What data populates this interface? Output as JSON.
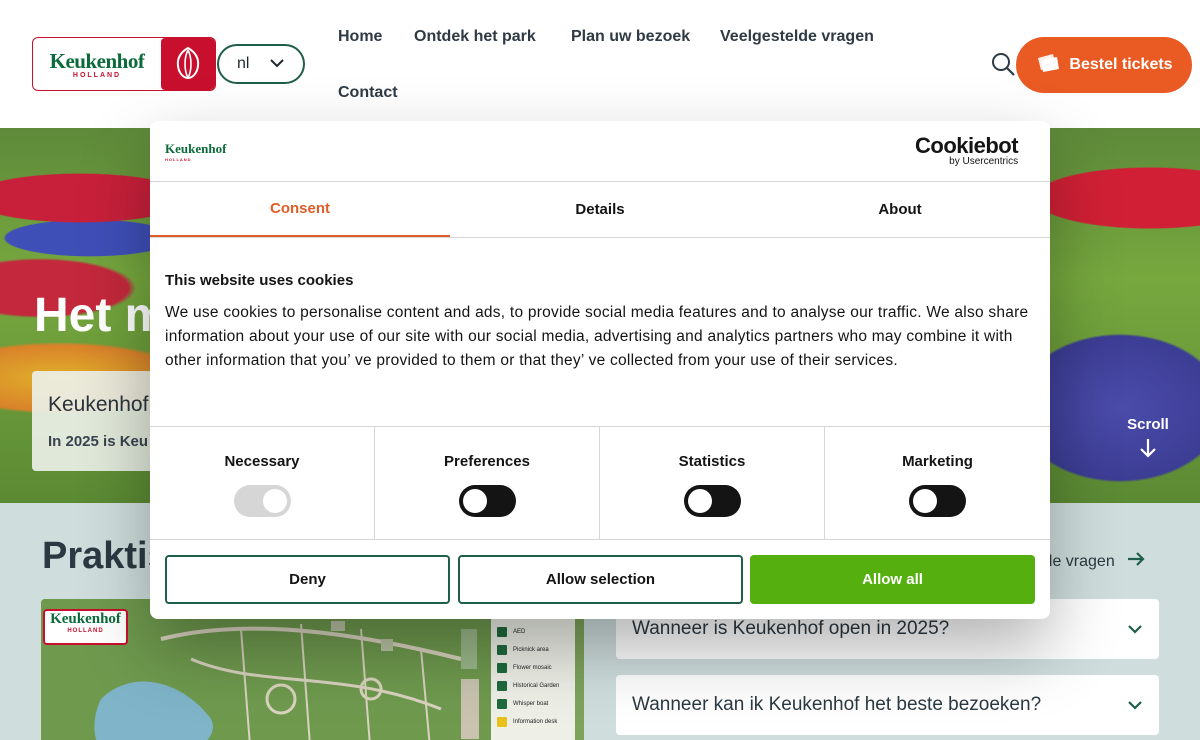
{
  "header": {
    "logo": {
      "word": "Keukenhof",
      "sub": "HOLLAND"
    },
    "lang": "nl",
    "nav": [
      "Home",
      "Ontdek het park",
      "Plan uw bezoek",
      "Veelgestelde vragen",
      "Contact"
    ],
    "cta": "Bestel tickets"
  },
  "hero": {
    "title": "Het m",
    "card_title": "Keukenhof",
    "card_text": "In 2025 is Keu",
    "scroll": "Scroll"
  },
  "lower": {
    "title": "Praktis",
    "faq_link": "lde vragen",
    "map_logo": {
      "word": "Keukenhof",
      "sub": "HOLLAND"
    },
    "map_legend": [
      "AED",
      "Picknick area",
      "Flower mosaic",
      "Historical Garden",
      "Whisper boat",
      "Information desk"
    ],
    "faqs": [
      "Wanneer is Keukenhof open in 2025?",
      "Wanneer kan ik Keukenhof het beste bezoeken?"
    ]
  },
  "cookie": {
    "logo": {
      "word": "Keukenhof",
      "sub": "HOLLAND"
    },
    "brand": {
      "name": "Cookiebot",
      "sub": "by Usercentrics"
    },
    "tabs": [
      "Consent",
      "Details",
      "About"
    ],
    "active_tab": "Consent",
    "heading": "This website uses cookies",
    "body": "We use cookies to personalise content and ads, to provide social media features and to analyse our traffic. We also share information about your use of our site with our social media, advertising and analytics partners who may combine it with other information that you’ ve provided to them or that they’ ve collected from your use of their services.",
    "categories": [
      {
        "label": "Necessary",
        "enabled": true,
        "locked": true
      },
      {
        "label": "Preferences",
        "enabled": false,
        "locked": false
      },
      {
        "label": "Statistics",
        "enabled": false,
        "locked": false
      },
      {
        "label": "Marketing",
        "enabled": false,
        "locked": false
      }
    ],
    "buttons": {
      "deny": "Deny",
      "selection": "Allow selection",
      "all": "Allow all"
    }
  },
  "colors": {
    "accent": "#ea5b24",
    "brand_red": "#c8102e",
    "brand_green": "#0c6b3a",
    "allow_green": "#55b00f",
    "tab_active": "#e05d27"
  }
}
